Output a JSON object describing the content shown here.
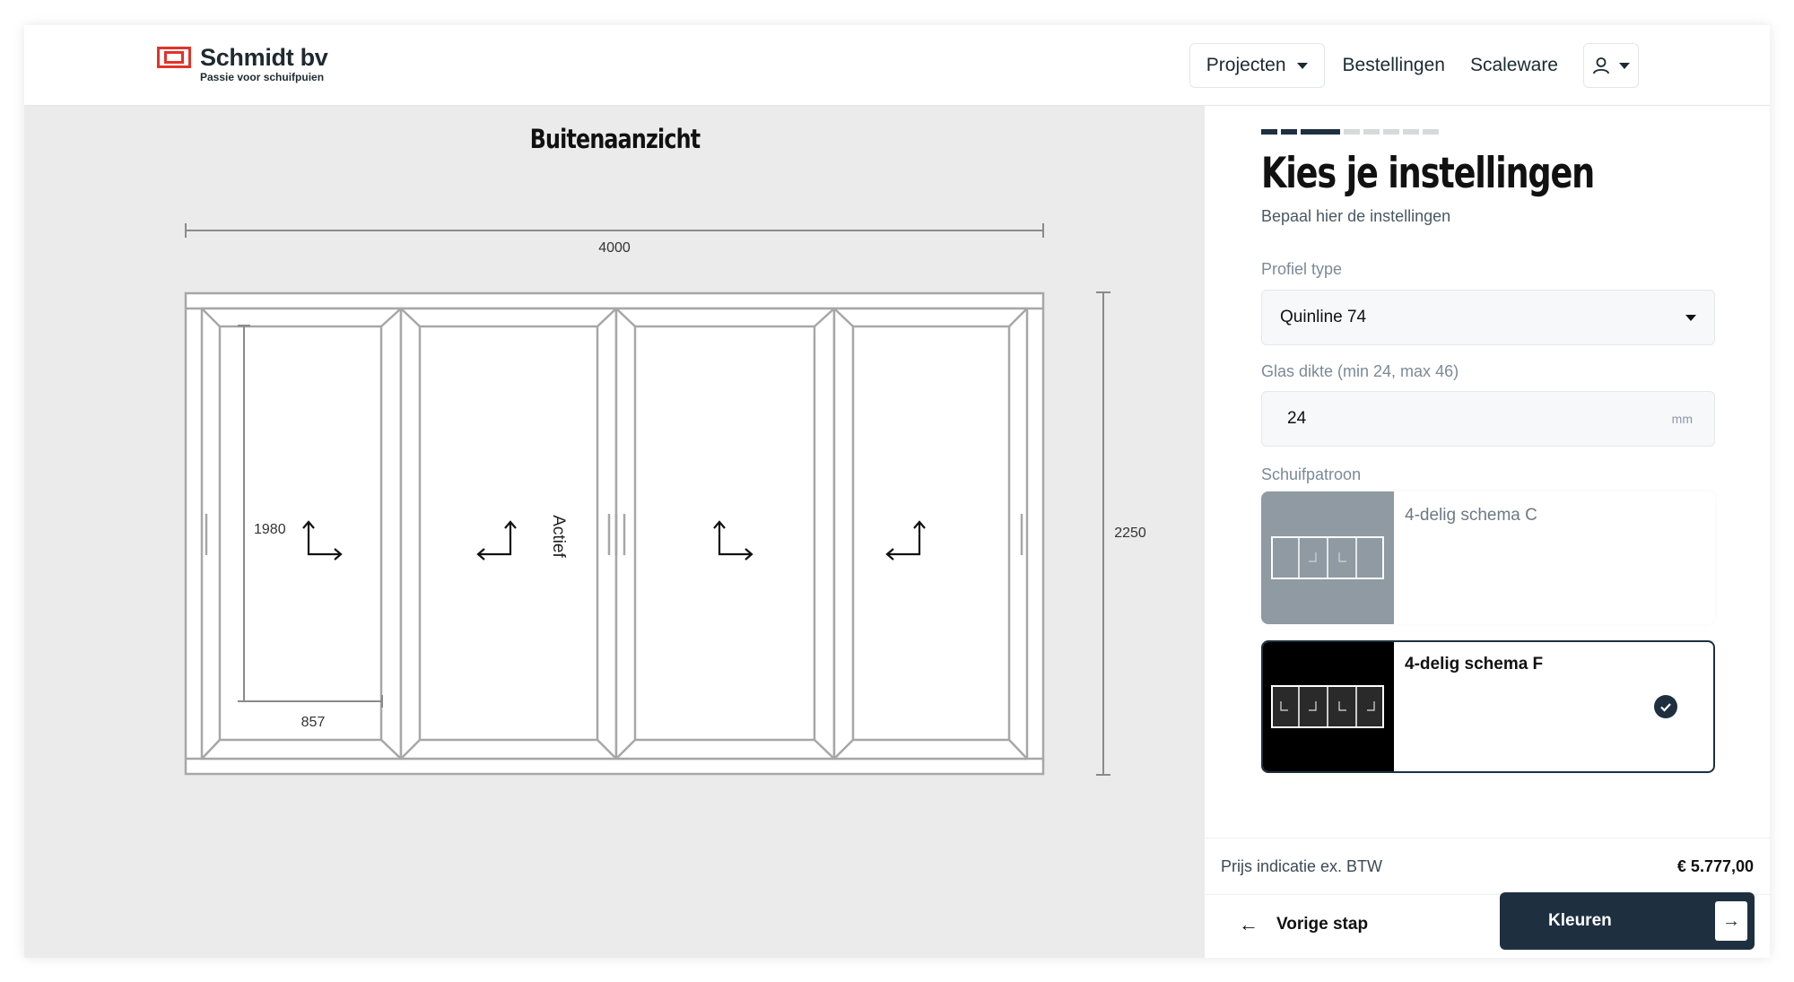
{
  "brand": {
    "name": "Schmidt bv",
    "tagline": "Passie voor schuifpuien"
  },
  "nav": {
    "projects": "Projecten",
    "orders": "Bestellingen",
    "scaleware": "Scaleware"
  },
  "canvas": {
    "title": "Buitenaanzicht",
    "width_dim": "4000",
    "height_dim": "2250",
    "panel_height_dim": "1980",
    "panel_width_dim": "857",
    "active_label": "Actief"
  },
  "panel": {
    "title": "Kies je instellingen",
    "subtitle": "Bepaal hier de instellingen",
    "steps": {
      "total": 8,
      "current": 3
    },
    "profile": {
      "label": "Profiel type",
      "value": "Quinline 74"
    },
    "glass": {
      "label": "Glas dikte (min 24, max 46)",
      "value": "24",
      "unit": "mm"
    },
    "pattern": {
      "label": "Schuifpatroon",
      "options": [
        {
          "label": "4-delig schema C",
          "selected": false
        },
        {
          "label": "4-delig schema F",
          "selected": true
        }
      ]
    },
    "price": {
      "label": "Prijs indicatie ex. BTW",
      "value": "€ 5.777,00"
    },
    "back_label": "Vorige stap",
    "next_label": "Kleuren"
  },
  "colors": {
    "primary": "#1e3040",
    "brand_red": "#e2332b",
    "canvas_bg": "#ebebeb"
  }
}
